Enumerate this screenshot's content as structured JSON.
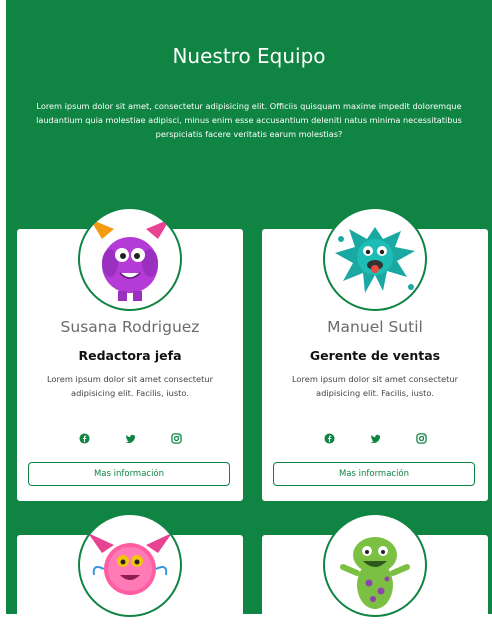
{
  "header": {
    "title": "Nuestro Equipo",
    "intro": "Lorem ipsum dolor sit amet, consectetur adipisicing elit. Officiis quisquam maxime impedit doloremque laudantium quia molestiae adipisci, minus enim esse accusantium deleniti natus minima necessitatibus perspiciatis facere veritatis earum molestias?"
  },
  "colors": {
    "brand": "#0f8443",
    "card": "#ffffff",
    "muted": "#6b6b6b"
  },
  "members": [
    {
      "name": "Susana Rodriguez",
      "role": "Redactora jefa",
      "description": "Lorem ipsum dolor sit amet consectetur adipisicing elit. Facilis, iusto.",
      "more_label": "Mas información",
      "avatar_icon": "purple-monster-icon"
    },
    {
      "name": "Manuel Sutil",
      "role": "Gerente de ventas",
      "description": "Lorem ipsum dolor sit amet consectetur adipisicing elit. Facilis, iusto.",
      "more_label": "Mas información",
      "avatar_icon": "teal-splat-monster-icon"
    },
    {
      "avatar_icon": "pink-fluffy-monster-icon"
    },
    {
      "avatar_icon": "green-spotted-monster-icon"
    }
  ],
  "social_icons": [
    "facebook-icon",
    "twitter-icon",
    "instagram-icon"
  ]
}
